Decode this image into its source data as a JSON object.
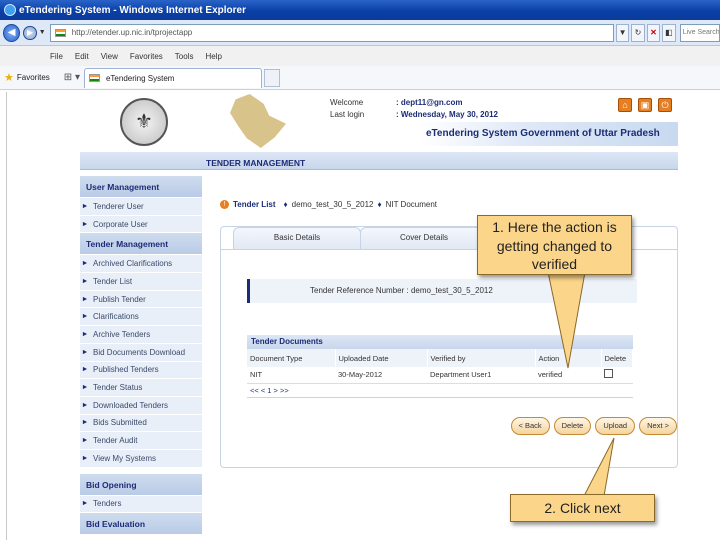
{
  "browser": {
    "title": "eTendering System - Windows Internet Explorer",
    "url": "http://etender.up.nic.in/tprojectapp",
    "search_placeholder": "Live Search",
    "menu": [
      "File",
      "Edit",
      "View",
      "Favorites",
      "Tools",
      "Help"
    ],
    "favorites_label": "Favorites",
    "tab_label": "eTendering System"
  },
  "header": {
    "welcome_label": "Welcome",
    "welcome_value": ":  dept11@gn.com",
    "last_login_label": "Last login",
    "last_login_value": ":  Wednesday, May 30, 2012",
    "banner": "eTendering System Government of Uttar Pradesh"
  },
  "section_title": "TENDER MANAGEMENT",
  "sidebar": {
    "groups": [
      {
        "title": "User Management",
        "items": [
          "Tenderer User",
          "Corporate User"
        ]
      },
      {
        "title": "Tender Management",
        "items": [
          "Archived Clarifications",
          "Tender List",
          "Publish Tender",
          "Clarifications",
          "Archive Tenders",
          "Bid Documents Download",
          "Published Tenders",
          "Tender Status",
          "Downloaded Tenders",
          "Bids Submitted",
          "Tender Audit",
          "View My Systems"
        ]
      },
      {
        "title": "Bid Opening",
        "items": [
          "Tenders"
        ]
      },
      {
        "title": "Bid Evaluation",
        "items": []
      }
    ]
  },
  "breadcrumb": {
    "root": "Tender List",
    "mid": "demo_test_30_5_2012",
    "leaf": "NIT Document"
  },
  "tabs": [
    "Basic Details",
    "Cover Details"
  ],
  "reference": {
    "label": "Tender Reference Number",
    "value": ":  demo_test_30_5_2012"
  },
  "documents": {
    "title": "Tender Documents",
    "columns": [
      "Document Type",
      "Uploaded Date",
      "Verified by",
      "Action",
      "Delete"
    ],
    "rows": [
      [
        "NIT",
        "30-May-2012",
        "Department User1",
        "verified"
      ]
    ],
    "pager": "<< < 1 > >>"
  },
  "buttons": {
    "back": "< Back",
    "delete": "Delete",
    "upload": "Upload",
    "next": "Next >"
  },
  "callouts": {
    "one": "1. Here the action is getting changed to verified",
    "two": "2. Click next"
  }
}
